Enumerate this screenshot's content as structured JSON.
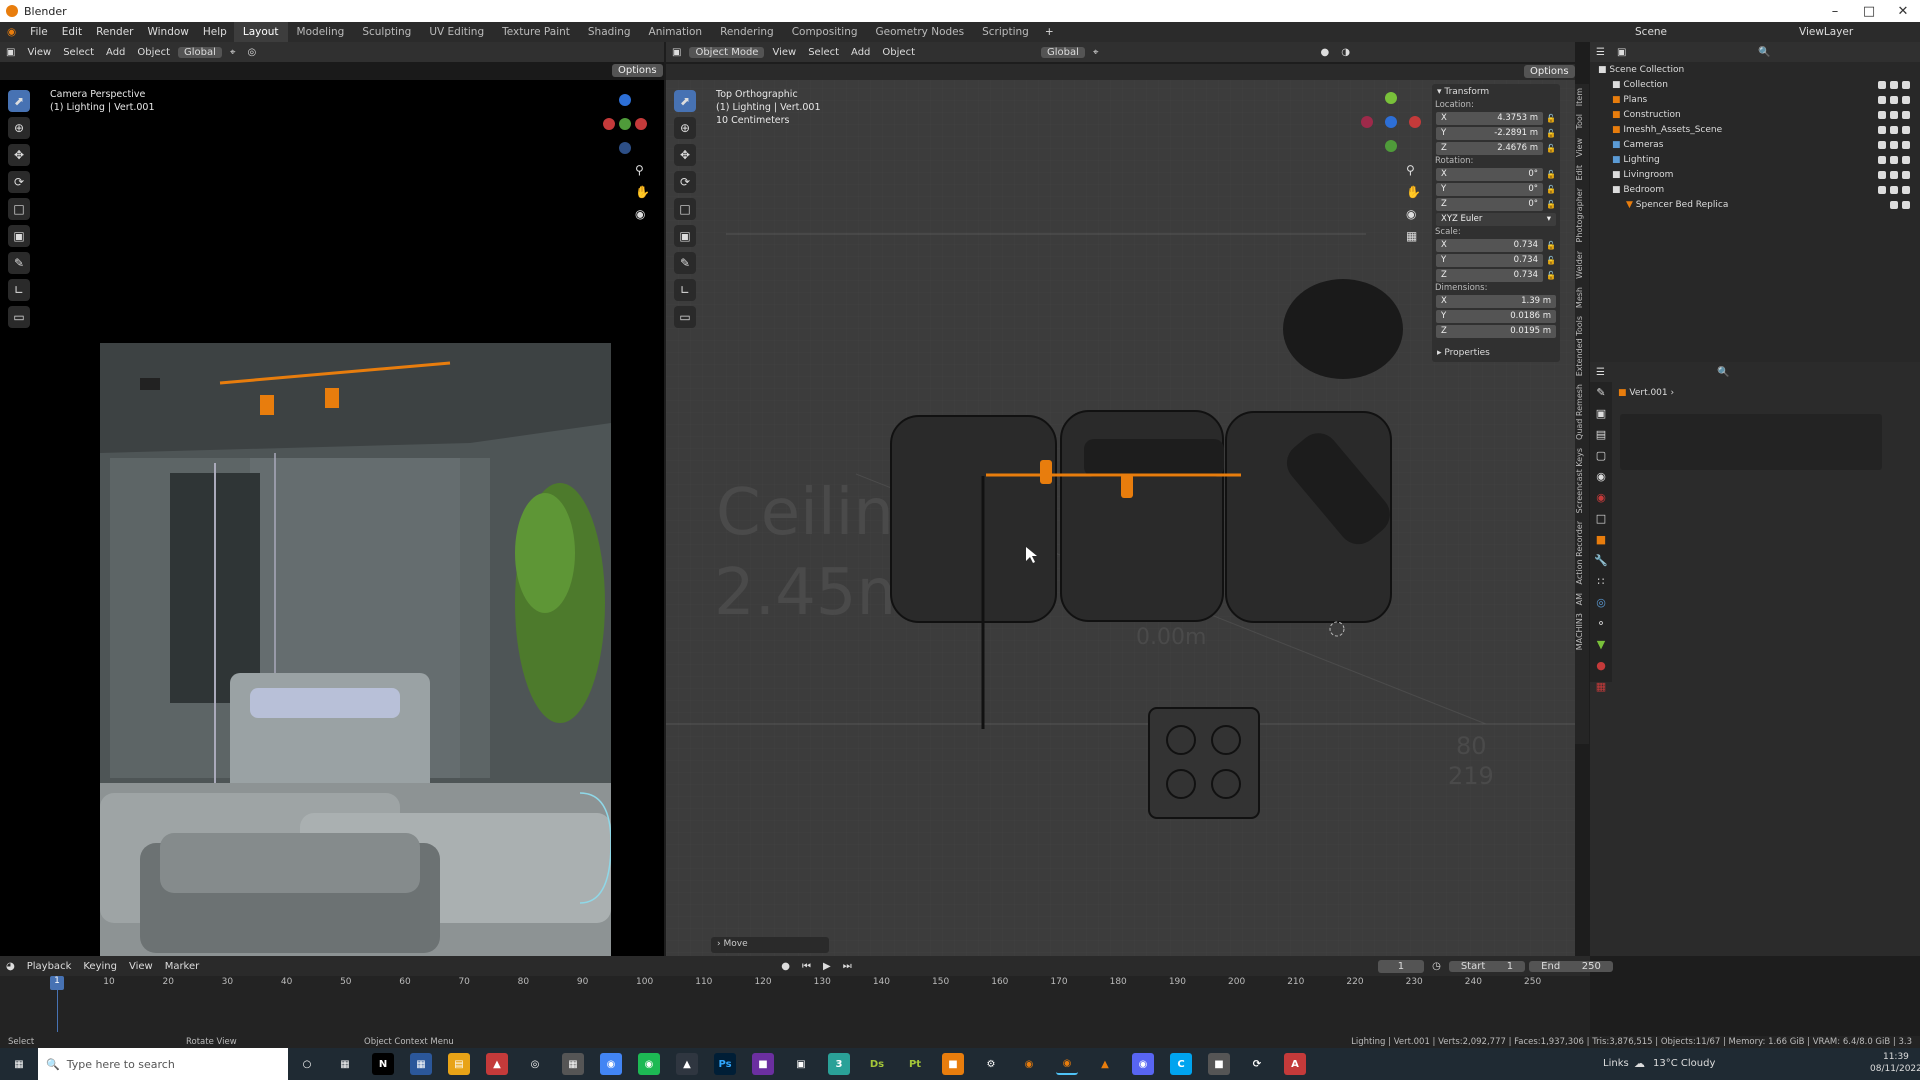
{
  "window": {
    "title": "Blender"
  },
  "menubar": {
    "menus": [
      "File",
      "Edit",
      "Render",
      "Window",
      "Help"
    ],
    "workspaces": [
      "Layout",
      "Modeling",
      "Sculpting",
      "UV Editing",
      "Texture Paint",
      "Shading",
      "Animation",
      "Rendering",
      "Compositing",
      "Geometry Nodes",
      "Scripting"
    ],
    "active_workspace": "Layout",
    "scene_label": "Scene",
    "viewlayer_label": "ViewLayer"
  },
  "left_viewport": {
    "header_menus": [
      "View",
      "Select",
      "Add",
      "Object"
    ],
    "orientation": "Global",
    "options_label": "Options",
    "overlay_line1": "Camera Perspective",
    "overlay_line2": "(1) Lighting | Vert.001"
  },
  "right_viewport": {
    "mode": "Object Mode",
    "header_menus": [
      "View",
      "Select",
      "Add",
      "Object"
    ],
    "orientation": "Global",
    "options_label": "Options",
    "overlay_line1": "Top Orthographic",
    "overlay_line2": "(1) Lighting | Vert.001",
    "overlay_line3": "10 Centimeters",
    "ghost_text1": "Ceiling",
    "ghost_text2": "2.45m",
    "ghost_text3": "0.00m",
    "ghost_text4": "80",
    "ghost_text5": "219",
    "operator_panel": "Move"
  },
  "npanel": {
    "title": "Transform",
    "location_label": "Location:",
    "location": [
      {
        "axis": "X",
        "value": "4.3753 m"
      },
      {
        "axis": "Y",
        "value": "-2.2891 m"
      },
      {
        "axis": "Z",
        "value": "2.4676 m"
      }
    ],
    "rotation_label": "Rotation:",
    "rotation": [
      {
        "axis": "X",
        "value": "0°"
      },
      {
        "axis": "Y",
        "value": "0°"
      },
      {
        "axis": "Z",
        "value": "0°"
      }
    ],
    "rotation_mode": "XYZ Euler",
    "scale_label": "Scale:",
    "scale": [
      {
        "axis": "X",
        "value": "0.734"
      },
      {
        "axis": "Y",
        "value": "0.734"
      },
      {
        "axis": "Z",
        "value": "0.734"
      }
    ],
    "dimensions_label": "Dimensions:",
    "dimensions": [
      {
        "axis": "X",
        "value": "1.39 m"
      },
      {
        "axis": "Y",
        "value": "0.0186 m"
      },
      {
        "axis": "Z",
        "value": "0.0195 m"
      }
    ],
    "properties_label": "Properties"
  },
  "sidetabs": [
    "Item",
    "Tool",
    "View",
    "Edit",
    "Photographer",
    "Welder",
    "Mesh",
    "Extended Tools",
    "Quad Remesh",
    "Screencast Keys",
    "Action Recorder",
    "AM",
    "MACHIN3"
  ],
  "outliner": {
    "root": "Scene Collection",
    "items": [
      {
        "name": "Collection",
        "indent": 1
      },
      {
        "name": "Plans",
        "indent": 1
      },
      {
        "name": "Construction",
        "indent": 1
      },
      {
        "name": "Imeshh_Assets_Scene",
        "indent": 1
      },
      {
        "name": "Cameras",
        "indent": 1
      },
      {
        "name": "Lighting",
        "indent": 1
      },
      {
        "name": "Livingroom",
        "indent": 1
      },
      {
        "name": "Bedroom",
        "indent": 1
      },
      {
        "name": "Spencer Bed Replica",
        "indent": 2
      }
    ]
  },
  "properties": {
    "object_name": "Vert.001"
  },
  "timeline": {
    "menus": [
      "Playback",
      "Keying",
      "View",
      "Marker"
    ],
    "current_frame": "1",
    "start_label": "Start",
    "start": "1",
    "end_label": "End",
    "end": "250",
    "ticks": [
      "1",
      "10",
      "20",
      "30",
      "40",
      "50",
      "60",
      "70",
      "80",
      "90",
      "100",
      "110",
      "120",
      "130",
      "140",
      "150",
      "160",
      "170",
      "180",
      "190",
      "200",
      "210",
      "220",
      "230",
      "240",
      "250"
    ]
  },
  "statusbar": {
    "select": "Select",
    "rotate": "Rotate View",
    "context": "Object Context Menu",
    "stats": "Lighting | Vert.001 | Verts:2,092,777 | Faces:1,937,306 | Tris:3,876,515 | Objects:11/67 | Memory: 1.66 GiB | VRAM: 6.4/8.0 GiB | 3.3"
  },
  "taskbar": {
    "search_placeholder": "Type here to search",
    "links": "Links",
    "weather": "13°C  Cloudy",
    "time": "11:39",
    "date": "08/11/2022"
  },
  "colors": {
    "accent": "#4772b3",
    "selection": "#e87d0d",
    "bg": "#1d1d1d"
  }
}
